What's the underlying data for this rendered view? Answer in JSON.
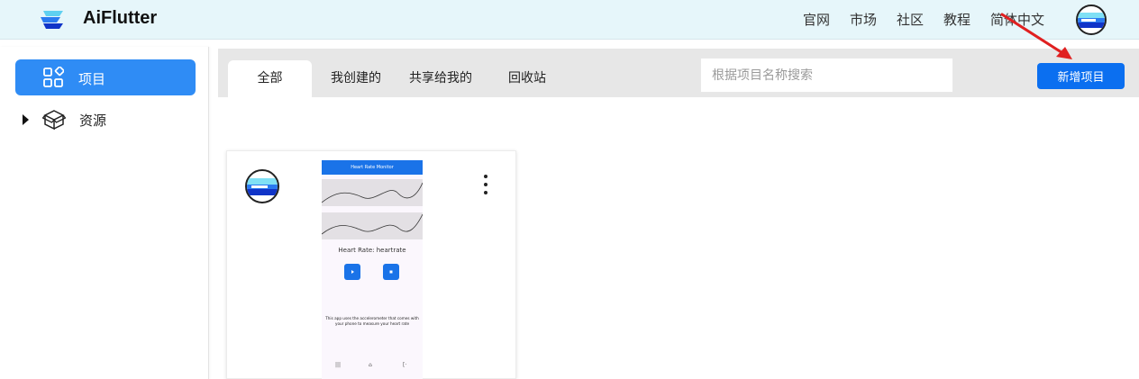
{
  "header": {
    "brand": "AiFlutter",
    "nav": [
      "官网",
      "市场",
      "社区",
      "教程",
      "简体中文"
    ]
  },
  "sidebar": {
    "items": [
      {
        "label": "项目",
        "icon": "apps-grid-icon",
        "active": true
      },
      {
        "label": "资源",
        "icon": "box-icon",
        "active": false
      }
    ]
  },
  "tabs": [
    "全部",
    "我创建的",
    "共享给我的",
    "回收站"
  ],
  "search": {
    "placeholder": "根据项目名称搜索",
    "value": ""
  },
  "new_button": "新增项目",
  "card": {
    "preview": {
      "app_title": "Heart Rate Monitor",
      "rate_text": "Heart Rate: heartrate",
      "description": "This app uses the accelerometer that comes with your phone to measure your heart rate",
      "nav": [
        "|||",
        "⌂",
        "[·"
      ]
    }
  },
  "colors": {
    "accent": "#2f8cf5",
    "button": "#0b6ff0",
    "topbar": "#e6f6fa",
    "annotation_arrow": "#e02020"
  }
}
